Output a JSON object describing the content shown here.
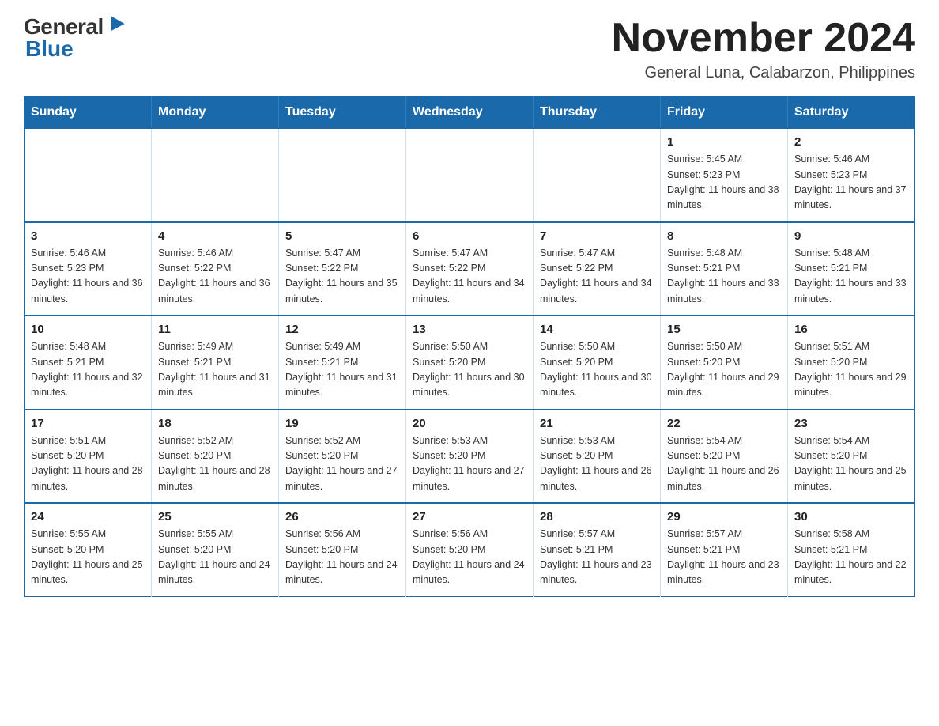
{
  "header": {
    "logo_general": "General",
    "logo_blue": "Blue",
    "month_title": "November 2024",
    "location": "General Luna, Calabarzon, Philippines"
  },
  "calendar": {
    "days_of_week": [
      "Sunday",
      "Monday",
      "Tuesday",
      "Wednesday",
      "Thursday",
      "Friday",
      "Saturday"
    ],
    "weeks": [
      [
        {
          "day": "",
          "info": ""
        },
        {
          "day": "",
          "info": ""
        },
        {
          "day": "",
          "info": ""
        },
        {
          "day": "",
          "info": ""
        },
        {
          "day": "",
          "info": ""
        },
        {
          "day": "1",
          "info": "Sunrise: 5:45 AM\nSunset: 5:23 PM\nDaylight: 11 hours and 38 minutes."
        },
        {
          "day": "2",
          "info": "Sunrise: 5:46 AM\nSunset: 5:23 PM\nDaylight: 11 hours and 37 minutes."
        }
      ],
      [
        {
          "day": "3",
          "info": "Sunrise: 5:46 AM\nSunset: 5:23 PM\nDaylight: 11 hours and 36 minutes."
        },
        {
          "day": "4",
          "info": "Sunrise: 5:46 AM\nSunset: 5:22 PM\nDaylight: 11 hours and 36 minutes."
        },
        {
          "day": "5",
          "info": "Sunrise: 5:47 AM\nSunset: 5:22 PM\nDaylight: 11 hours and 35 minutes."
        },
        {
          "day": "6",
          "info": "Sunrise: 5:47 AM\nSunset: 5:22 PM\nDaylight: 11 hours and 34 minutes."
        },
        {
          "day": "7",
          "info": "Sunrise: 5:47 AM\nSunset: 5:22 PM\nDaylight: 11 hours and 34 minutes."
        },
        {
          "day": "8",
          "info": "Sunrise: 5:48 AM\nSunset: 5:21 PM\nDaylight: 11 hours and 33 minutes."
        },
        {
          "day": "9",
          "info": "Sunrise: 5:48 AM\nSunset: 5:21 PM\nDaylight: 11 hours and 33 minutes."
        }
      ],
      [
        {
          "day": "10",
          "info": "Sunrise: 5:48 AM\nSunset: 5:21 PM\nDaylight: 11 hours and 32 minutes."
        },
        {
          "day": "11",
          "info": "Sunrise: 5:49 AM\nSunset: 5:21 PM\nDaylight: 11 hours and 31 minutes."
        },
        {
          "day": "12",
          "info": "Sunrise: 5:49 AM\nSunset: 5:21 PM\nDaylight: 11 hours and 31 minutes."
        },
        {
          "day": "13",
          "info": "Sunrise: 5:50 AM\nSunset: 5:20 PM\nDaylight: 11 hours and 30 minutes."
        },
        {
          "day": "14",
          "info": "Sunrise: 5:50 AM\nSunset: 5:20 PM\nDaylight: 11 hours and 30 minutes."
        },
        {
          "day": "15",
          "info": "Sunrise: 5:50 AM\nSunset: 5:20 PM\nDaylight: 11 hours and 29 minutes."
        },
        {
          "day": "16",
          "info": "Sunrise: 5:51 AM\nSunset: 5:20 PM\nDaylight: 11 hours and 29 minutes."
        }
      ],
      [
        {
          "day": "17",
          "info": "Sunrise: 5:51 AM\nSunset: 5:20 PM\nDaylight: 11 hours and 28 minutes."
        },
        {
          "day": "18",
          "info": "Sunrise: 5:52 AM\nSunset: 5:20 PM\nDaylight: 11 hours and 28 minutes."
        },
        {
          "day": "19",
          "info": "Sunrise: 5:52 AM\nSunset: 5:20 PM\nDaylight: 11 hours and 27 minutes."
        },
        {
          "day": "20",
          "info": "Sunrise: 5:53 AM\nSunset: 5:20 PM\nDaylight: 11 hours and 27 minutes."
        },
        {
          "day": "21",
          "info": "Sunrise: 5:53 AM\nSunset: 5:20 PM\nDaylight: 11 hours and 26 minutes."
        },
        {
          "day": "22",
          "info": "Sunrise: 5:54 AM\nSunset: 5:20 PM\nDaylight: 11 hours and 26 minutes."
        },
        {
          "day": "23",
          "info": "Sunrise: 5:54 AM\nSunset: 5:20 PM\nDaylight: 11 hours and 25 minutes."
        }
      ],
      [
        {
          "day": "24",
          "info": "Sunrise: 5:55 AM\nSunset: 5:20 PM\nDaylight: 11 hours and 25 minutes."
        },
        {
          "day": "25",
          "info": "Sunrise: 5:55 AM\nSunset: 5:20 PM\nDaylight: 11 hours and 24 minutes."
        },
        {
          "day": "26",
          "info": "Sunrise: 5:56 AM\nSunset: 5:20 PM\nDaylight: 11 hours and 24 minutes."
        },
        {
          "day": "27",
          "info": "Sunrise: 5:56 AM\nSunset: 5:20 PM\nDaylight: 11 hours and 24 minutes."
        },
        {
          "day": "28",
          "info": "Sunrise: 5:57 AM\nSunset: 5:21 PM\nDaylight: 11 hours and 23 minutes."
        },
        {
          "day": "29",
          "info": "Sunrise: 5:57 AM\nSunset: 5:21 PM\nDaylight: 11 hours and 23 minutes."
        },
        {
          "day": "30",
          "info": "Sunrise: 5:58 AM\nSunset: 5:21 PM\nDaylight: 11 hours and 22 minutes."
        }
      ]
    ]
  }
}
